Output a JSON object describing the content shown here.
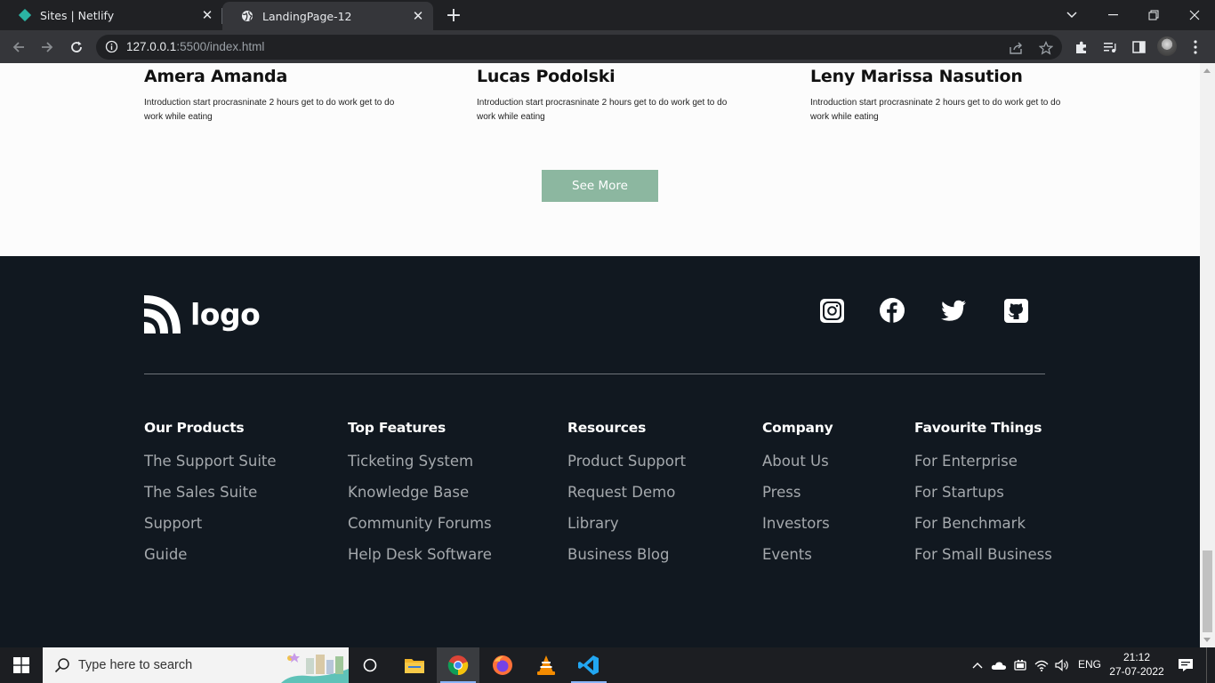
{
  "browser": {
    "tabs": [
      {
        "title": "Sites | Netlify",
        "active": false
      },
      {
        "title": "LandingPage-12",
        "active": true
      }
    ],
    "url_host": "127.0.0.1",
    "url_rest": ":5500/index.html"
  },
  "team": [
    {
      "name": "Amera Amanda",
      "desc": "Introduction start procrasninate 2 hours get to do work get to do work while eating"
    },
    {
      "name": "Lucas Podolski",
      "desc": "Introduction start procrasninate 2 hours get to do work get to do work while eating"
    },
    {
      "name": "Leny Marissa Nasution",
      "desc": "Introduction start procrasninate 2 hours get to do work get to do work while eating"
    }
  ],
  "see_more_label": "See More",
  "footer": {
    "logo_text": "logo",
    "social": [
      "instagram-icon",
      "facebook-icon",
      "twitter-icon",
      "github-icon"
    ],
    "columns": [
      {
        "heading": "Our Products",
        "links": [
          "The Support Suite",
          "The Sales Suite",
          "Support",
          "Guide"
        ]
      },
      {
        "heading": "Top Features",
        "links": [
          "Ticketing System",
          "Knowledge Base",
          "Community Forums",
          "Help Desk Software"
        ]
      },
      {
        "heading": "Resources",
        "links": [
          "Product Support",
          "Request Demo",
          "Library",
          "Business Blog"
        ]
      },
      {
        "heading": "Company",
        "links": [
          "About Us",
          "Press",
          "Investors",
          "Events"
        ]
      },
      {
        "heading": "Favourite Things",
        "links": [
          "For Enterprise",
          "For Startups",
          "For Benchmark",
          "For Small Business"
        ]
      }
    ]
  },
  "taskbar": {
    "search_placeholder": "Type here to search",
    "language": "ENG",
    "time": "21:12",
    "date": "27-07-2022"
  },
  "colors": {
    "accent": "#8cb7a0",
    "footer_bg": "#111820"
  }
}
